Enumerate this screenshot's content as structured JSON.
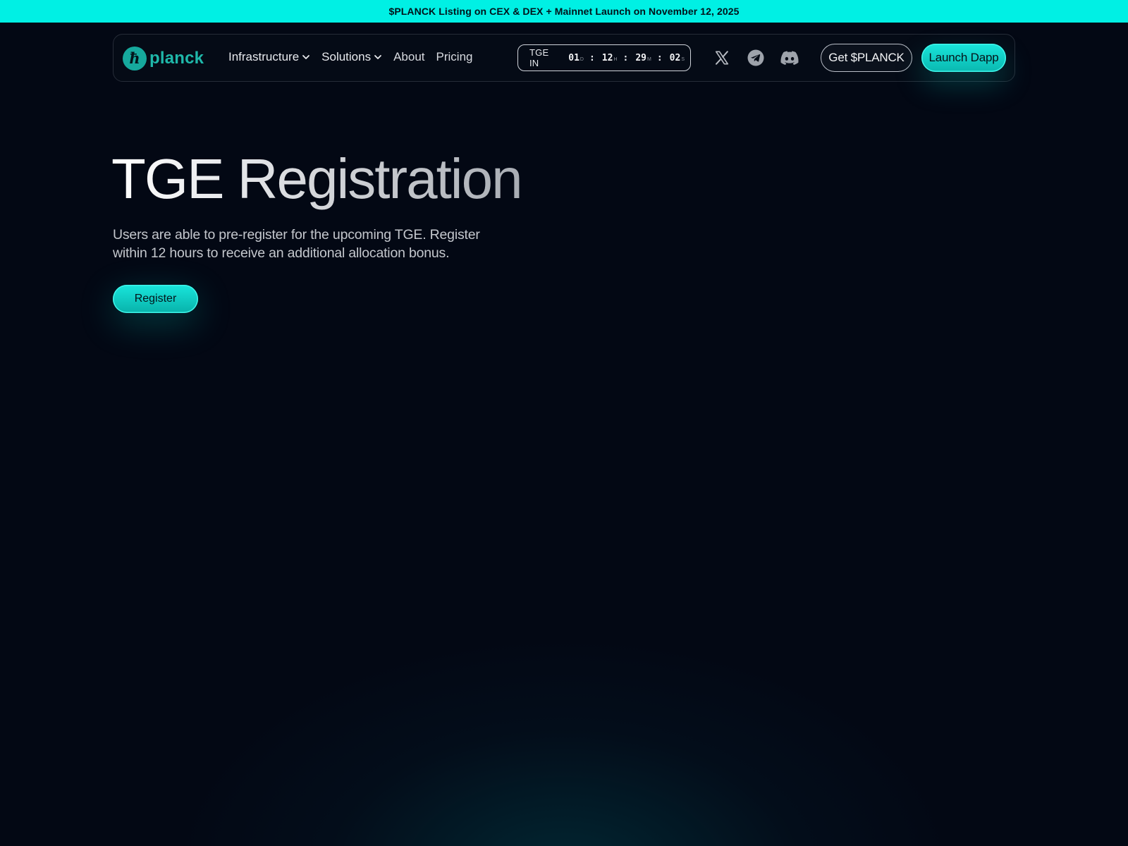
{
  "banner": {
    "text": "$PLANCK Listing on CEX & DEX + Mainnet Launch on November 12, 2025"
  },
  "brand": {
    "name": "planck",
    "accent": "#00f0e4",
    "logo_color": "#1fb8aa"
  },
  "nav": {
    "items": [
      {
        "label": "Infrastructure",
        "dropdown": true
      },
      {
        "label": "Solutions",
        "dropdown": true
      },
      {
        "label": "About",
        "dropdown": false
      },
      {
        "label": "Pricing",
        "dropdown": false
      }
    ]
  },
  "countdown": {
    "label": "TGE IN",
    "days": "01",
    "days_unit": "D",
    "hours": "12",
    "hours_unit": "H",
    "minutes": "29",
    "minutes_unit": "M",
    "seconds": "02",
    "seconds_unit": "S",
    "separator": ":"
  },
  "socials": [
    {
      "icon": "x-icon"
    },
    {
      "icon": "telegram-icon"
    },
    {
      "icon": "discord-icon"
    }
  ],
  "buttons": {
    "get_token": "Get $PLANCK",
    "launch": "Launch Dapp"
  },
  "hero": {
    "title": "TGE Registration",
    "description": "Users are able to pre-register for the upcoming TGE. Register within 12 hours to receive an additional allocation bonus.",
    "cta": "Register"
  }
}
